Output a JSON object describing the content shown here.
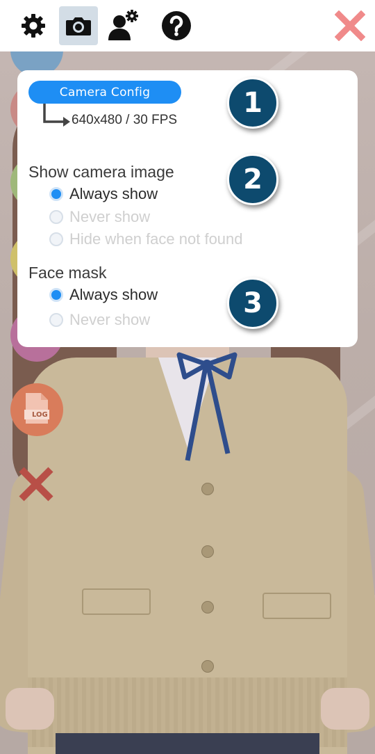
{
  "toolbar": {
    "buttons": [
      {
        "icon": "gear-icon"
      },
      {
        "icon": "camera-icon",
        "active": true
      },
      {
        "icon": "user-settings-icon"
      },
      {
        "icon": "help-icon"
      }
    ],
    "close_icon": "close-icon",
    "close_color": "#f08a8a"
  },
  "panel": {
    "camera_config": {
      "button_label": "Camera Config",
      "value": "640x480 / 30 FPS",
      "badge": "1"
    },
    "show_camera_image": {
      "title": "Show camera image",
      "badge": "2",
      "options": [
        {
          "label": "Always show",
          "selected": true
        },
        {
          "label": "Never show",
          "selected": false
        },
        {
          "label": "Hide when face not found",
          "selected": false
        }
      ]
    },
    "face_mask": {
      "title": "Face mask",
      "badge": "3",
      "options": [
        {
          "label": "Always show",
          "selected": true
        },
        {
          "label": "Never show",
          "selected": false
        }
      ]
    }
  },
  "side_menu": {
    "log_button": "LOG",
    "log_icon": "log-file-icon",
    "close_icon": "close-icon"
  },
  "colors": {
    "accent": "#1e8ef4",
    "badge": "#0d4a6e",
    "close": "#f08a8a",
    "log_button": "#d97c5b"
  }
}
